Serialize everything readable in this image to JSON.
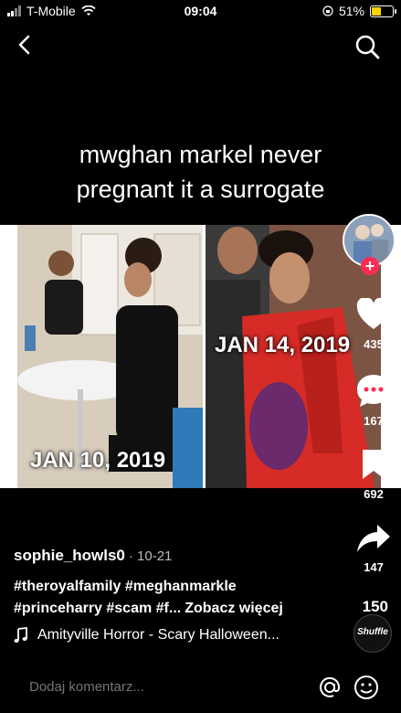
{
  "status_bar": {
    "carrier": "T-Mobile",
    "time": "09:04",
    "battery_percent": "51%",
    "battery_level": 0.51,
    "battery_color": "#f5d400"
  },
  "nav": {
    "back_icon": "chevron-left-icon",
    "search_icon": "search-icon"
  },
  "caption": {
    "line1": "mwghan markel never",
    "line2": "pregnant it a surrogate"
  },
  "video": {
    "left_date": "JAN 10, 2019",
    "right_date": "JAN 14, 2019"
  },
  "actions": {
    "likes": "435",
    "comments": "167",
    "bookmarks": "692",
    "shares": "147",
    "like_color": "#ffffff",
    "follow_color": "#fe2c55"
  },
  "post": {
    "username": "sophie_howls0",
    "date": "· 10-21",
    "hashtags_line1": "#theroyalfamily #meghanmarkle",
    "hashtags_line2": "#princeharry #scam #f...",
    "see_more": "Zobacz więcej",
    "music": "Amityville Horror - Scary Halloween...",
    "sticker_count": "150",
    "sticker_label": "Shuffle"
  },
  "comment_bar": {
    "placeholder": "Dodaj komentarz..."
  }
}
